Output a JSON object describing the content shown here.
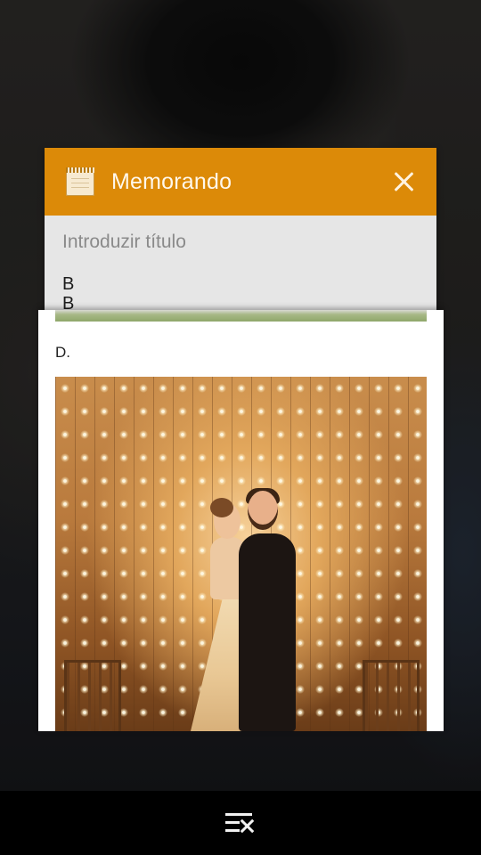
{
  "memo": {
    "app_title": "Memorando",
    "title_placeholder": "Introduzir título",
    "body_text": "B",
    "body_text_cut": "B",
    "header_color": "#dc8a08"
  },
  "document": {
    "label": "D."
  },
  "navbar": {
    "clear_all_icon": "clear-all-icon"
  }
}
